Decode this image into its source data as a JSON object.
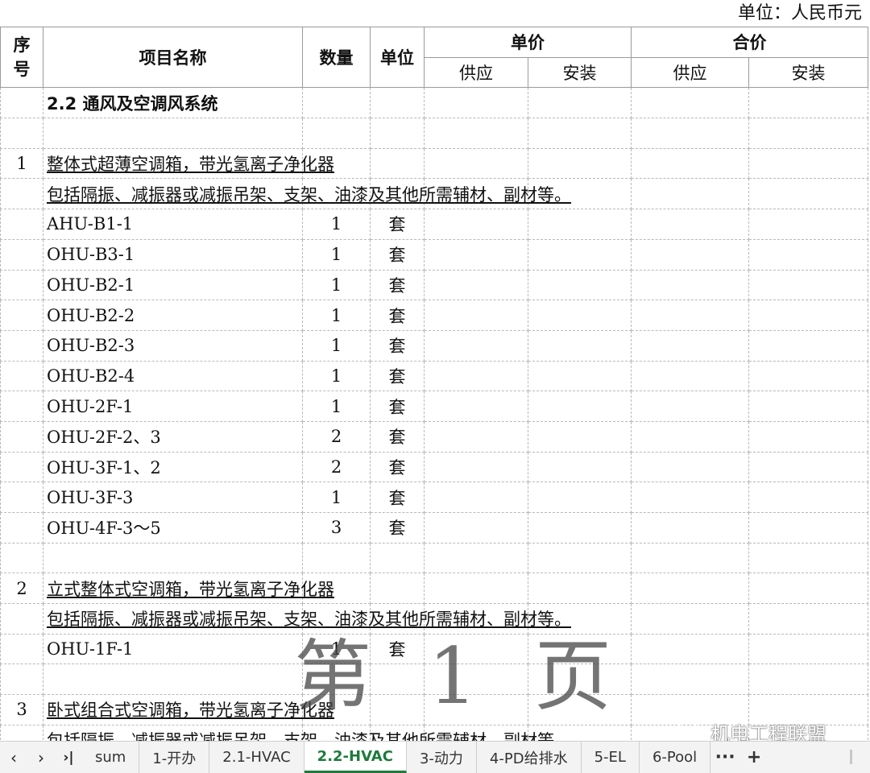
{
  "unit_label": "单位：人民币元",
  "header": {
    "seq": "序号",
    "name": "项目名称",
    "qty": "数量",
    "unit": "单位",
    "unit_price": "单价",
    "total_price": "合价",
    "supply": "供应",
    "install": "安装"
  },
  "rows": [
    {
      "type": "section",
      "seq": "",
      "name": "2.2 通风及空调风系统",
      "qty": "",
      "unit": ""
    },
    {
      "type": "blank",
      "seq": "",
      "name": "",
      "qty": "",
      "unit": ""
    },
    {
      "type": "title",
      "seq": "1",
      "name": "整体式超薄空调箱，带光氢离子净化器",
      "qty": "",
      "unit": ""
    },
    {
      "type": "title",
      "seq": "",
      "name": "包括隔振、减振器或减振吊架、支架、油漆及其他所需辅材、副材等。",
      "qty": "",
      "unit": ""
    },
    {
      "type": "item",
      "seq": "",
      "name": "AHU-B1-1",
      "qty": "1",
      "unit": "套"
    },
    {
      "type": "item",
      "seq": "",
      "name": "OHU-B3-1",
      "qty": "1",
      "unit": "套"
    },
    {
      "type": "item",
      "seq": "",
      "name": "OHU-B2-1",
      "qty": "1",
      "unit": "套"
    },
    {
      "type": "item",
      "seq": "",
      "name": "OHU-B2-2",
      "qty": "1",
      "unit": "套"
    },
    {
      "type": "item",
      "seq": "",
      "name": "OHU-B2-3",
      "qty": "1",
      "unit": "套"
    },
    {
      "type": "item",
      "seq": "",
      "name": "OHU-B2-4",
      "qty": "1",
      "unit": "套"
    },
    {
      "type": "item",
      "seq": "",
      "name": "OHU-2F-1",
      "qty": "1",
      "unit": "套"
    },
    {
      "type": "item",
      "seq": "",
      "name": "OHU-2F-2、3",
      "qty": "2",
      "unit": "套"
    },
    {
      "type": "item",
      "seq": "",
      "name": "OHU-3F-1、2",
      "qty": "2",
      "unit": "套"
    },
    {
      "type": "item",
      "seq": "",
      "name": "OHU-3F-3",
      "qty": "1",
      "unit": "套"
    },
    {
      "type": "item",
      "seq": "",
      "name": "OHU-4F-3～5",
      "qty": "3",
      "unit": "套"
    },
    {
      "type": "blank",
      "seq": "",
      "name": "",
      "qty": "",
      "unit": ""
    },
    {
      "type": "title",
      "seq": "2",
      "name": "立式整体式空调箱，带光氢离子净化器",
      "qty": "",
      "unit": ""
    },
    {
      "type": "title",
      "seq": "",
      "name": "包括隔振、减振器或减振吊架、支架、油漆及其他所需辅材、副材等。",
      "qty": "",
      "unit": ""
    },
    {
      "type": "item",
      "seq": "",
      "name": "OHU-1F-1",
      "qty": "1",
      "unit": "套"
    },
    {
      "type": "blank",
      "seq": "",
      "name": "",
      "qty": "",
      "unit": ""
    },
    {
      "type": "title",
      "seq": "3",
      "name": "卧式组合式空调箱，带光氢离子净化器",
      "qty": "",
      "unit": ""
    },
    {
      "type": "title",
      "seq": "",
      "name": "包括隔振、减振器或减振吊架、支架、油漆及其他所需辅材、副材等。",
      "qty": "",
      "unit": ""
    }
  ],
  "watermark": "第 1 页",
  "wechat_label": "机电工程联盟",
  "tabs": [
    "sum",
    "1-开办",
    "2.1-HVAC",
    "2.2-HVAC",
    "3-动力",
    "4-PD给排水",
    "5-EL",
    "6-Pool"
  ],
  "active_tab": "2.2-HVAC",
  "nav": {
    "prev": "‹",
    "next": "›",
    "last": "›|",
    "more": "···",
    "add": "+"
  },
  "colors": {
    "active_tab": "#1e7a3c"
  }
}
